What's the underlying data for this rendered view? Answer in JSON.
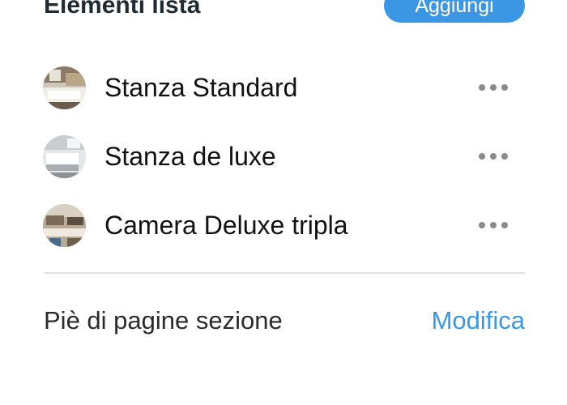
{
  "header": {
    "title": "Elementi lista",
    "add_label": "Aggiungi"
  },
  "list": {
    "items": [
      {
        "label": "Stanza Standard",
        "thumbnail": "room-photo-standard",
        "menu_icon": "more-horizontal-icon"
      },
      {
        "label": "Stanza de luxe",
        "thumbnail": "room-photo-deluxe",
        "menu_icon": "more-horizontal-icon"
      },
      {
        "label": "Camera Deluxe tripla",
        "thumbnail": "room-photo-triple",
        "menu_icon": "more-horizontal-icon"
      }
    ]
  },
  "footer": {
    "text": "Piè di pagine sezione",
    "edit_label": "Modifica"
  },
  "colors": {
    "accent": "#3b97e3",
    "text": "#111111",
    "header_text": "#1f2a33",
    "divider": "#e3e3e3",
    "menu_dots": "#8a8a8a"
  }
}
